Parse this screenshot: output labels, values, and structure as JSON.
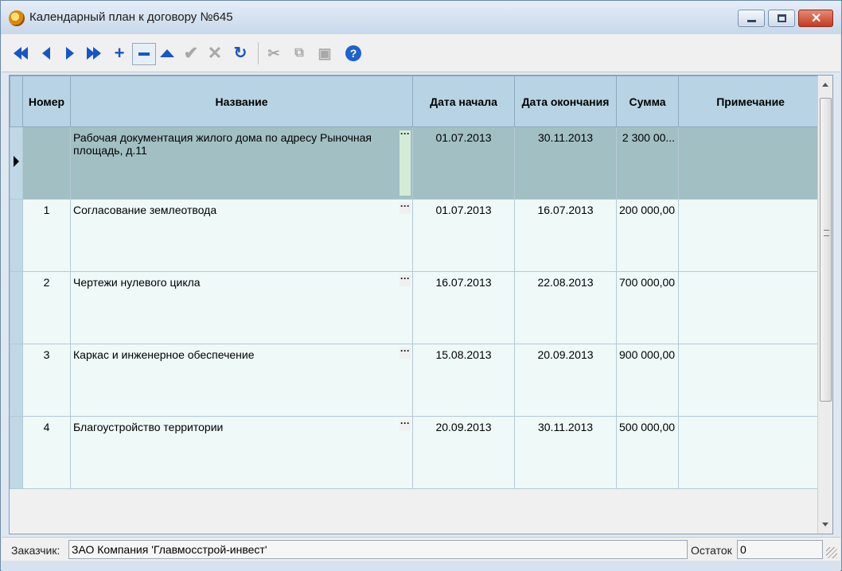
{
  "window": {
    "title": "Календарный план к договору №645"
  },
  "toolbar": {
    "buttons": [
      {
        "name": "first-record",
        "icon": "double-arrow-left-icon"
      },
      {
        "name": "prev-record",
        "icon": "arrow-left-icon"
      },
      {
        "name": "next-record",
        "icon": "arrow-right-icon"
      },
      {
        "name": "last-record",
        "icon": "double-arrow-right-icon"
      },
      {
        "name": "add-record",
        "icon": "plus-icon"
      },
      {
        "name": "delete-record",
        "icon": "minus-icon"
      },
      {
        "name": "edit-record",
        "icon": "triangle-up-icon"
      },
      {
        "name": "post-edit",
        "icon": "checkmark-icon"
      },
      {
        "name": "cancel-edit",
        "icon": "x-icon"
      },
      {
        "name": "refresh",
        "icon": "refresh-icon"
      },
      {
        "name": "cut",
        "icon": "scissors-icon"
      },
      {
        "name": "copy",
        "icon": "copy-icon"
      },
      {
        "name": "paste",
        "icon": "paste-icon"
      },
      {
        "name": "help",
        "icon": "help-icon"
      }
    ]
  },
  "grid": {
    "columns": [
      "Номер",
      "Название",
      "Дата начала",
      "Дата окончания",
      "Сумма",
      "Примечание"
    ],
    "rows": [
      {
        "num": "",
        "name": "Рабочая документация жилого дома по адресу Рыночная площадь, д.11",
        "start": "01.07.2013",
        "end": "30.11.2013",
        "sum": "2 300 00...",
        "note": "",
        "selected": true
      },
      {
        "num": "1",
        "name": "Согласование землеотвода",
        "start": "01.07.2013",
        "end": "16.07.2013",
        "sum": "200 000,00",
        "note": ""
      },
      {
        "num": "2",
        "name": "Чертежи нулевого цикла",
        "start": "16.07.2013",
        "end": "22.08.2013",
        "sum": "700 000,00",
        "note": ""
      },
      {
        "num": "3",
        "name": "Каркас и инженерное обеспечение",
        "start": "15.08.2013",
        "end": "20.09.2013",
        "sum": "900 000,00",
        "note": ""
      },
      {
        "num": "4",
        "name": "Благоустройство территории",
        "start": "20.09.2013",
        "end": "30.11.2013",
        "sum": "500 000,00",
        "note": ""
      }
    ]
  },
  "status": {
    "customer_label": "Заказчик:",
    "customer_value": "ЗАО Компания 'Главмосстрой-инвест'",
    "remainder_label": "Остаток",
    "remainder_value": "0"
  },
  "colors": {
    "header_bg": "#b8d3e4",
    "selected_row": "#a2bfc3",
    "row_bg": "#eef9f8",
    "nav_icon": "#1556c8"
  }
}
